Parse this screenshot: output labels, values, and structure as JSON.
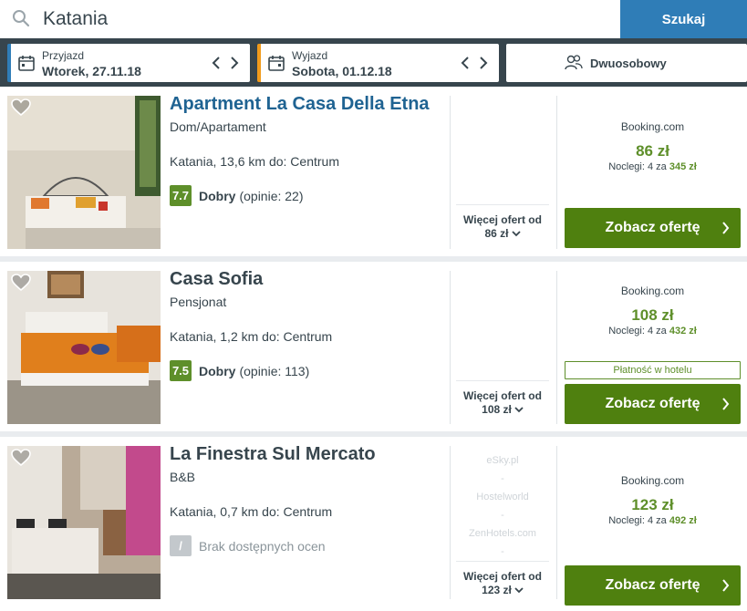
{
  "search": {
    "query": "Katania",
    "button_label": "Szukaj"
  },
  "dates": {
    "checkin": {
      "label": "Przyjazd",
      "value": "Wtorek, 27.11.18"
    },
    "checkout": {
      "label": "Wyjazd",
      "value": "Sobota, 01.12.18"
    },
    "guests": {
      "value": "Dwuosobowy"
    }
  },
  "colors": {
    "accent_blue": "#2f7db7",
    "checkout_orange": "#f09a1b",
    "price_green": "#5e8f2a",
    "cta_green": "#4f800f",
    "header_dark": "#37454d"
  },
  "results": [
    {
      "name": "Apartment La Casa Della Etna",
      "type": "Dom/Apartament",
      "location": "Katania, 13,6 km do: Centrum",
      "score": "7.7",
      "rating_label": "Dobry",
      "rating_count": "(opinie: 22)",
      "more_offers": "Więcej ofert od",
      "more_price": "86 zł",
      "provider": "Booking.com",
      "price": "86 zł",
      "nights_prefix": "Noclegi: 4 za",
      "nights_total": "345 zł",
      "cta": "Zobacz ofertę"
    },
    {
      "name": "Casa Sofia",
      "type": "Pensjonat",
      "location": "Katania, 1,2 km do: Centrum",
      "score": "7.5",
      "rating_label": "Dobry",
      "rating_count": "(opinie: 113)",
      "more_offers": "Więcej ofert od",
      "more_price": "108 zł",
      "provider": "Booking.com",
      "price": "108 zł",
      "nights_prefix": "Noclegi: 4 za",
      "nights_total": "432 zł",
      "pay_note": "Płatność w hotelu",
      "cta": "Zobacz ofertę"
    },
    {
      "name": "La Finestra Sul Mercato",
      "type": "B&B",
      "location": "Katania, 0,7 km do: Centrum",
      "score": "/",
      "no_rating": "Brak dostępnych ocen",
      "other_providers": [
        "eSky.pl",
        "-",
        "Hostelworld",
        "-",
        "ZenHotels.com",
        "-"
      ],
      "more_offers": "Więcej ofert od",
      "more_price": "123 zł",
      "provider": "Booking.com",
      "price": "123 zł",
      "nights_prefix": "Noclegi: 4 za",
      "nights_total": "492 zł",
      "cta": "Zobacz ofertę"
    }
  ]
}
